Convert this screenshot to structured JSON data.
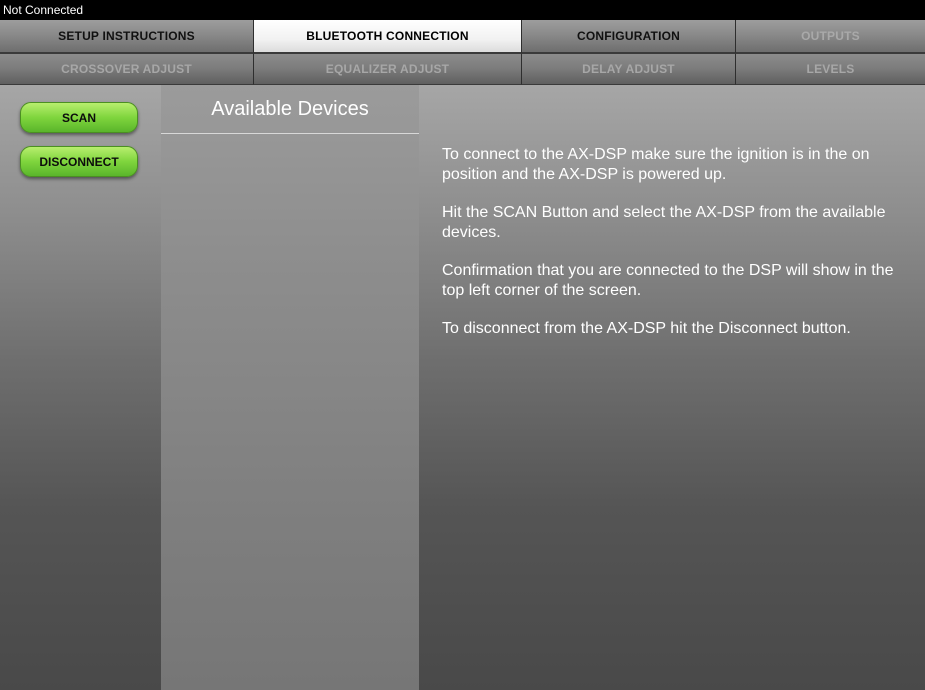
{
  "status": {
    "text": "Not Connected"
  },
  "tabs_row1": [
    {
      "label": "SETUP INSTRUCTIONS",
      "state": "normal"
    },
    {
      "label": "BLUETOOTH CONNECTION",
      "state": "active"
    },
    {
      "label": "CONFIGURATION",
      "state": "normal"
    },
    {
      "label": "OUTPUTS",
      "state": "disabled"
    }
  ],
  "tabs_row2": [
    {
      "label": "CROSSOVER ADJUST",
      "state": "disabled"
    },
    {
      "label": "EQUALIZER ADJUST",
      "state": "disabled"
    },
    {
      "label": "DELAY ADJUST",
      "state": "disabled"
    },
    {
      "label": "LEVELS",
      "state": "disabled"
    }
  ],
  "buttons": {
    "scan": "SCAN",
    "disconnect": "DISCONNECT"
  },
  "devices": {
    "title": "Available Devices",
    "items": []
  },
  "instructions": [
    "To connect to the AX-DSP make sure the ignition is in the on position and the AX-DSP is powered up.",
    "Hit the SCAN Button and select the AX-DSP from the available devices.",
    "Confirmation that you are connected to the DSP will show in the top left corner of the screen.",
    "To disconnect from the AX-DSP hit the Disconnect button."
  ],
  "colors": {
    "button_green": "#7fd53d",
    "active_tab": "#f2f2f2",
    "status_bar": "#000000"
  }
}
